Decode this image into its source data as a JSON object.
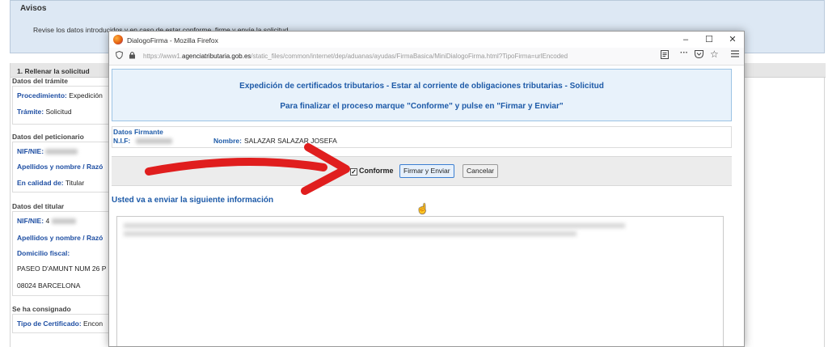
{
  "background": {
    "avisos": {
      "title": "Avisos",
      "text": "Revise los datos introducidos y en caso de estar conforme, firme y envíe la solicitud"
    },
    "step": {
      "title": "1. Rellenar la solicitud"
    },
    "tramite": {
      "title": "Datos del trámite",
      "procedimiento_label": "Procedimiento:",
      "procedimiento_value": "Expedición",
      "tramite_label": "Trámite:",
      "tramite_value": "Solicitud"
    },
    "peticionario": {
      "title": "Datos del peticionario",
      "nif_label": "NIF/NIE:",
      "apellidos_label": "Apellidos y nombre / Razó",
      "calidad_label": "En calidad de:",
      "calidad_value": "Titular"
    },
    "titular": {
      "title": "Datos del titular",
      "nif_label": "NIF/NIE:",
      "nif_value_partial": "4",
      "apellidos_label": "Apellidos y nombre / Razó",
      "domicilio_label": "Domicilio fiscal:",
      "address_line1": "PASEO D'AMUNT NUM 26 P",
      "address_line2": "08024 BARCELONA"
    },
    "consignado": {
      "title": "Se ha consignado",
      "tipo_label": "Tipo de Certificado:",
      "tipo_value": "Encon"
    }
  },
  "popup": {
    "window_title": "DialogoFirma - Mozilla Firefox",
    "window_controls": {
      "minimize": "–",
      "maximize": "☐",
      "close": "✕"
    },
    "url": {
      "prefix": "https://www1.",
      "domain": "agenciatributaria.gob.es",
      "path": "/static_files/common/internet/dep/aduanas/ayudas/FirmaBasica/MiniDialogoFirma.html?TipoFirma=urlEncoded"
    },
    "toolbar_icons": [
      "reader-icon",
      "more-icon",
      "pocket-icon",
      "star-icon",
      "menu-icon"
    ],
    "header_line1": "Expedición de certificados tributarios - Estar al corriente de obligaciones tributarias - Solicitud",
    "header_line2": "Para finalizar el proceso marque \"Conforme\" y pulse en \"Firmar y Enviar\"",
    "firmante": {
      "title": "Datos Firmante",
      "nif_label": "N.I.F:",
      "nombre_label": "Nombre:",
      "nombre_value": "SALAZAR SALAZAR JOSEFA"
    },
    "actions": {
      "conforme_label": "Conforme",
      "conforme_checked": true,
      "firmar_label": "Firmar y Enviar",
      "cancelar_label": "Cancelar"
    },
    "info_title": "Usted va a enviar la siguiente información"
  },
  "colors": {
    "link_blue": "#1d5aa8",
    "header_bg": "#e8f2fb",
    "arrow_red": "#e01e1e"
  }
}
